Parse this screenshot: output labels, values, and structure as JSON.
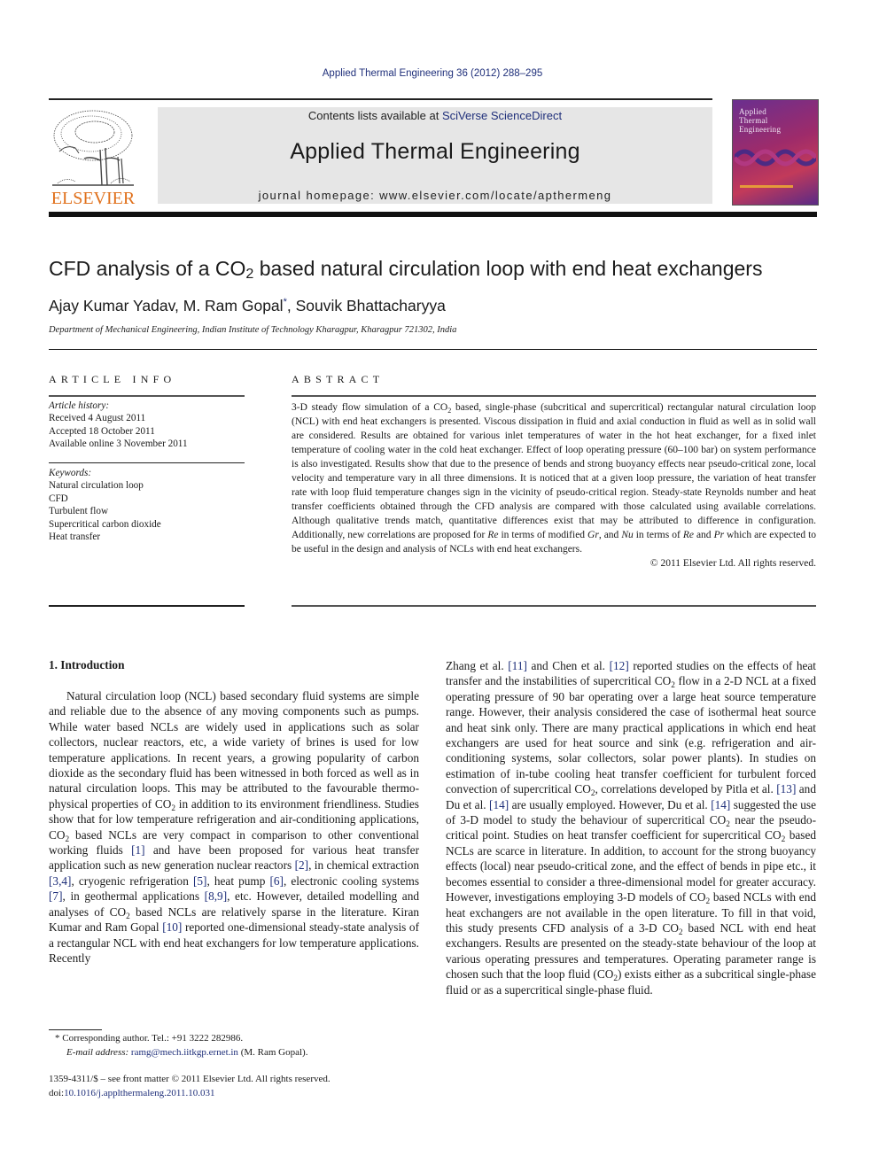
{
  "header": {
    "citation": "Applied Thermal Engineering 36 (2012) 288–295",
    "contents_prefix": "Contents lists available at ",
    "contents_link": "SciVerse ScienceDirect",
    "journal_name": "Applied Thermal Engineering",
    "homepage": "journal homepage: www.elsevier.com/locate/apthermeng",
    "publisher_logo_text": "ELSEVIER",
    "cover_title": "Applied\nThermal\nEngineering",
    "colors": {
      "link": "#1f2f7a",
      "elsevier_orange": "#e0701b",
      "banner_bg": "#e6e6e6"
    }
  },
  "article": {
    "title_pre": "CFD analysis of a CO",
    "title_sub": "2",
    "title_post": " based natural circulation loop with end heat exchangers",
    "authors_pre": "Ajay Kumar Yadav, M. Ram Gopal",
    "author_mark": "*",
    "authors_post": ", Souvik Bhattacharyya",
    "affiliation": "Department of Mechanical Engineering, Indian Institute of Technology Kharagpur, Kharagpur 721302, India"
  },
  "article_info": {
    "heading": "ARTICLE INFO",
    "history_label": "Article history:",
    "history": [
      "Received 4 August 2011",
      "Accepted 18 October 2011",
      "Available online 3 November 2011"
    ],
    "keywords_label": "Keywords:",
    "keywords": [
      "Natural circulation loop",
      "CFD",
      "Turbulent flow",
      "Supercritical carbon dioxide",
      "Heat transfer"
    ]
  },
  "abstract": {
    "heading": "ABSTRACT",
    "p1": "3-D steady flow simulation of a CO",
    "p1_sub": "2",
    "p2": " based, single-phase (subcritical and supercritical) rectangular natural circulation loop (NCL) with end heat exchangers is presented. Viscous dissipation in fluid and axial conduction in fluid as well as in solid wall are considered. Results are obtained for various inlet temperatures of water in the hot heat exchanger, for a fixed inlet temperature of cooling water in the cold heat exchanger. Effect of loop operating pressure (60–100 bar) on system performance is also investigated. Results show that due to the presence of bends and strong buoyancy effects near pseudo-critical zone, local velocity and temperature vary in all three dimensions. It is noticed that at a given loop pressure, the variation of heat transfer rate with loop fluid temperature changes sign in the vicinity of pseudo-critical region. Steady-state Reynolds number and heat transfer coefficients obtained through the CFD analysis are compared with those calculated using available correlations. Although qualitative trends match, quantitative differences exist that may be attributed to difference in configuration. Additionally, new correlations are proposed for ",
    "re1": "Re",
    "p3": " in terms of modified ",
    "gr": "Gr",
    "p4": ", and ",
    "nu": "Nu",
    "p5": " in terms of ",
    "re2": "Re",
    "p6": " and ",
    "pr": "Pr",
    "p7": " which are expected to be useful in the design and analysis of NCLs with end heat exchangers.",
    "copyright": "© 2011 Elsevier Ltd. All rights reserved."
  },
  "introduction": {
    "heading": "1.  Introduction",
    "left": {
      "t1": "Natural circulation loop (NCL) based secondary fluid systems are simple and reliable due to the absence of any moving components such as pumps. While water based NCLs are widely used in applications such as solar collectors, nuclear reactors, etc, a wide variety of brines is used for low temperature applications. In recent years, a growing popularity of carbon dioxide as the secondary fluid has been witnessed in both forced as well as in natural circulation loops. This may be attributed to the favourable thermo-physical properties of CO",
      "t2": " in addition to its environment friendliness. Studies show that for low temperature refrigeration and air-conditioning applications, CO",
      "t3": " based NCLs are very compact in comparison to other conventional working fluids ",
      "r1": "[1]",
      "t4": " and have been proposed for various heat transfer application such as new generation nuclear reactors ",
      "r2": "[2]",
      "t5": ", in chemical extraction ",
      "r3": "[3,4]",
      "t6": ", cryogenic refrigeration ",
      "r5": "[5]",
      "t7": ", heat pump ",
      "r6": "[6]",
      "t8": ", electronic cooling systems ",
      "r7": "[7]",
      "t9": ", in geothermal applications ",
      "r8": "[8,9]",
      "t10": ", etc. However, detailed modelling and analyses of CO",
      "t11": " based NCLs are relatively sparse in the literature. Kiran Kumar and Ram Gopal ",
      "r10": "[10]",
      "t12": " reported one-dimensional steady-state analysis of a rectangular NCL with end heat exchangers for low temperature applications. Recently"
    },
    "right": {
      "t1": "Zhang et al. ",
      "r11": "[11]",
      "t2": " and Chen et al. ",
      "r12": "[12]",
      "t3": " reported studies on the effects of heat transfer and the instabilities of supercritical CO",
      "t4": " flow in a 2-D NCL at a fixed operating pressure of 90 bar operating over a large heat source temperature range. However, their analysis considered the case of isothermal heat source and heat sink only. There are many practical applications in which end heat exchangers are used for heat source and sink (e.g. refrigeration and air-conditioning systems, solar collectors, solar power plants). In studies on estimation of in-tube cooling heat transfer coefficient for turbulent forced convection of supercritical CO",
      "t5": ", correlations developed by Pitla et al. ",
      "r13": "[13]",
      "t6": " and Du et al. ",
      "r14": "[14]",
      "t7": " are usually employed. However, Du et al. ",
      "r14b": "[14]",
      "t8": " suggested the use of 3-D model to study the behaviour of supercritical CO",
      "t9": " near the pseudo-critical point. Studies on heat transfer coefficient for supercritical CO",
      "t10": " based NCLs are scarce in literature. In addition, to account for the strong buoyancy effects (local) near pseudo-critical zone, and the effect of bends in pipe etc., it becomes essential to consider a three-dimensional model for greater accuracy. However, investigations employing 3-D models of CO",
      "t11": " based NCLs with end heat exchangers are not available in the open literature. To fill in that void, this study presents CFD analysis of a 3-D CO",
      "t12": " based NCL with end heat exchangers. Results are presented on the steady-state behaviour of the loop at various operating pressures and temperatures. Operating parameter range is chosen such that the loop fluid (CO",
      "t13": ") exists either as a subcritical single-phase fluid or as a supercritical single-phase fluid."
    },
    "sub2": "2"
  },
  "footnote": {
    "mark": "*",
    "corresponding": " Corresponding author. Tel.: +91 3222 282986.",
    "email_label": "E-mail address: ",
    "email": "ramg@mech.iitkgp.ernet.in",
    "email_owner": " (M. Ram Gopal).",
    "issn": "1359-4311/$ – see front matter © 2011 Elsevier Ltd. All rights reserved.",
    "doi_label": "doi:",
    "doi": "10.1016/j.applthermaleng.2011.10.031"
  }
}
